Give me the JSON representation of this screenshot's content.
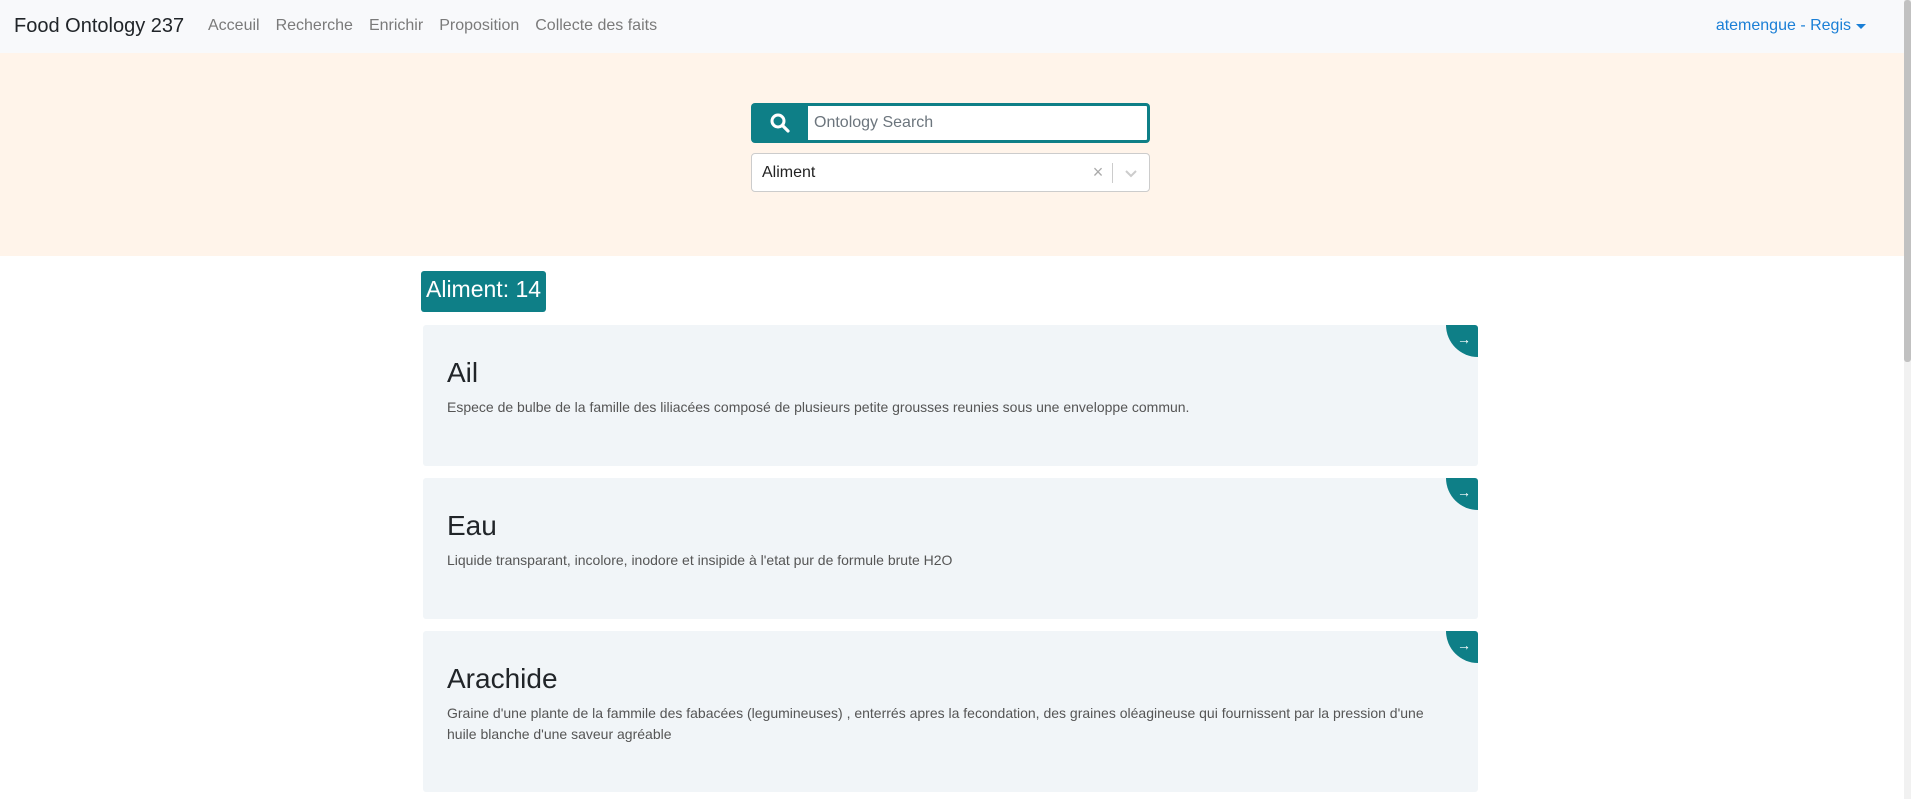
{
  "navbar": {
    "brand": "Food Ontology 237",
    "links": [
      "Acceuil",
      "Recherche",
      "Enrichir",
      "Proposition",
      "Collecte des faits"
    ],
    "user": "atemengue - Regis"
  },
  "search": {
    "placeholder": "Ontology Search",
    "value": ""
  },
  "filter": {
    "selected": "Aliment",
    "clear": "×"
  },
  "results": {
    "count_label": "Aliment: 14",
    "items": [
      {
        "title": "Ail",
        "description": "Espece de bulbe de la famille des liliacées composé de plusieurs petite grousses reunies sous une enveloppe commun."
      },
      {
        "title": "Eau",
        "description": "Liquide transparant, incolore, inodore et insipide à l'etat pur de formule brute H2O"
      },
      {
        "title": "Arachide",
        "description": "Graine d'une plante de la fammile des fabacées (legumineuses) , enterrés apres la fecondation, des graines oléagineuse qui fournissent par la pression d'une huile blanche d'une saveur agréable"
      }
    ],
    "arrow": "→"
  },
  "colors": {
    "accent": "#0e7f87",
    "band": "#fff4ea",
    "card": "#f1f5f8",
    "link": "#1a7fd6"
  }
}
